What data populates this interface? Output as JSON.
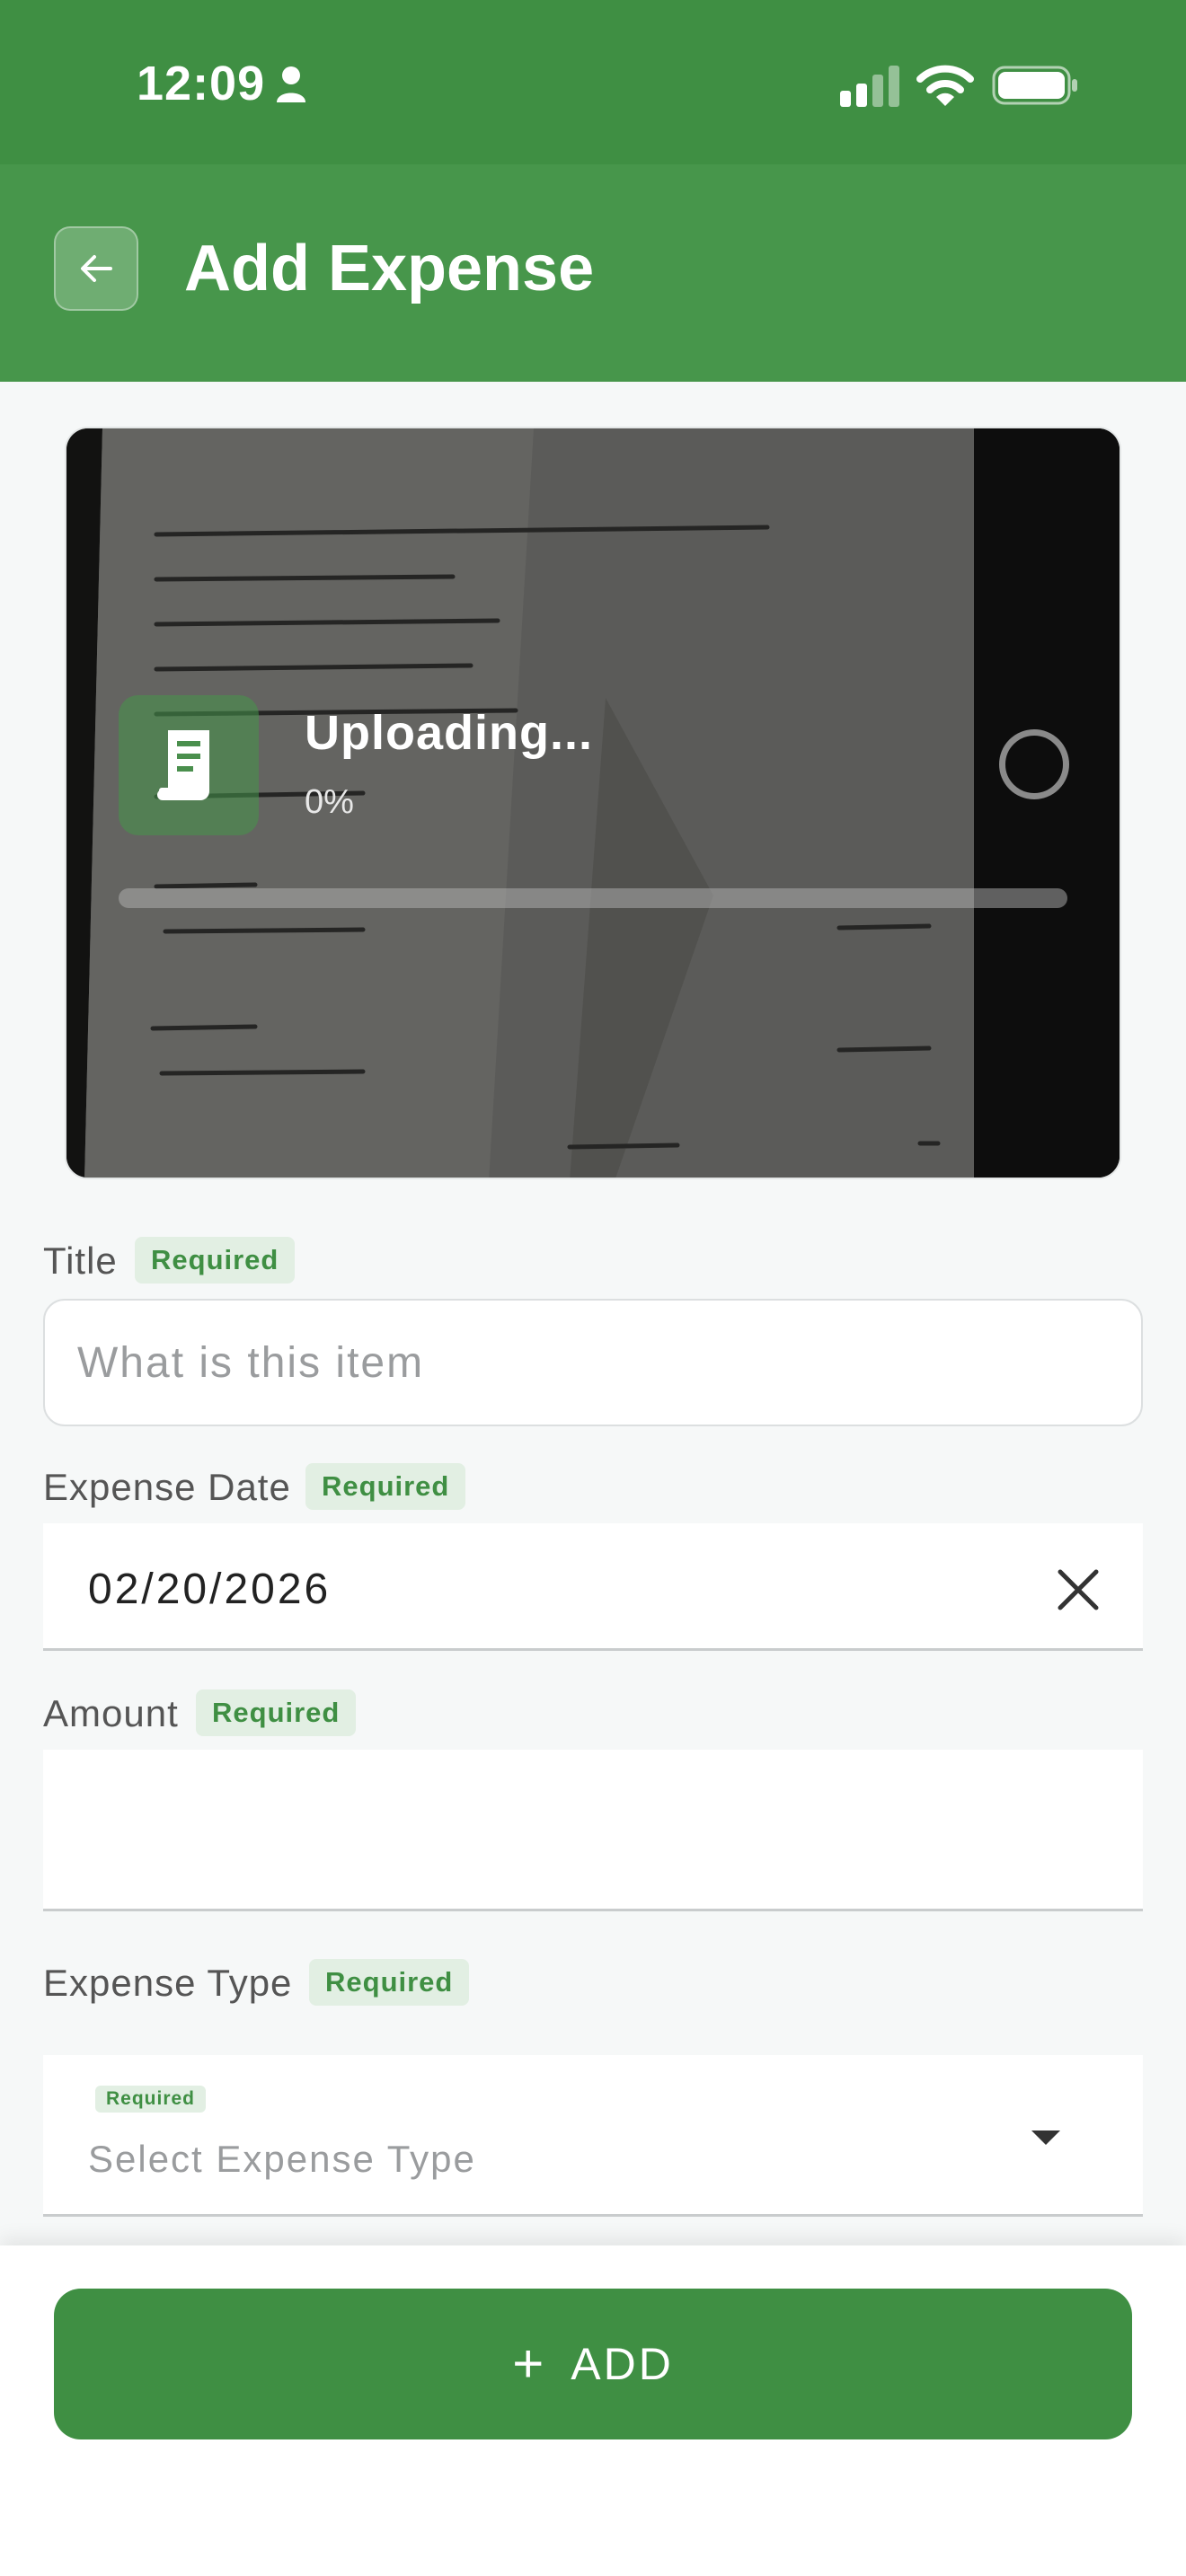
{
  "status_bar": {
    "time": "12:09"
  },
  "header": {
    "title": "Add Expense",
    "back_icon": "arrow-left-icon"
  },
  "upload": {
    "title": "Uploading...",
    "percent_text": "0%",
    "progress": 0,
    "icon": "receipt-icon"
  },
  "form": {
    "title": {
      "label": "Title",
      "badge": "Required",
      "placeholder": "What is this item",
      "value": ""
    },
    "expense_date": {
      "label": "Expense Date",
      "badge": "Required",
      "value": "02/20/2026"
    },
    "amount": {
      "label": "Amount",
      "badge": "Required",
      "value": ""
    },
    "expense_type": {
      "label": "Expense Type",
      "badge": "Required",
      "inner_badge": "Required",
      "placeholder": "Select Expense Type"
    }
  },
  "footer": {
    "add_label": "ADD",
    "add_icon": "plus-icon"
  },
  "colors": {
    "primary": "#47964b",
    "primary_dark": "#3f8f43",
    "badge_bg": "#e2efe3"
  }
}
